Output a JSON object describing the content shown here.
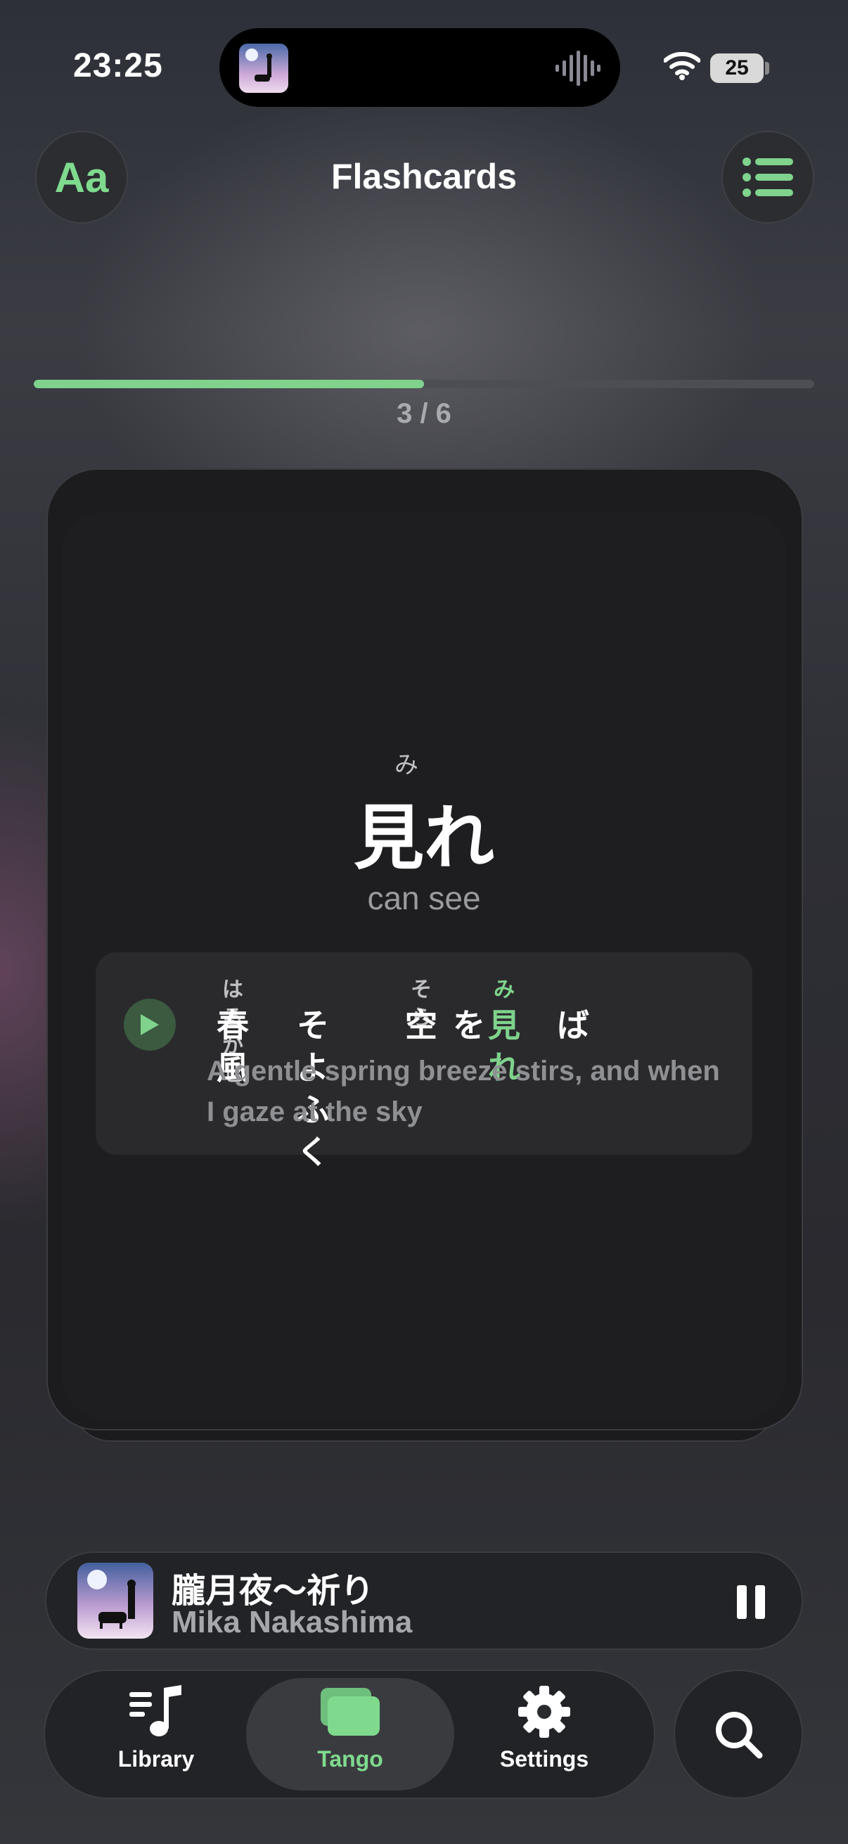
{
  "status_bar": {
    "time": "23:25",
    "battery": "25"
  },
  "header": {
    "title": "Flashcards",
    "font_button_label": "Aa"
  },
  "progress": {
    "label": "3 / 6",
    "current": 3,
    "total": 6,
    "fraction": 0.5
  },
  "card": {
    "reading": "み",
    "word": "見れ",
    "meaning": "can see",
    "example": {
      "segments": [
        {
          "text": "春風",
          "reading": "はるかぜ",
          "highlight": false
        },
        {
          "text": "そよふく",
          "reading": "",
          "highlight": false
        },
        {
          "text": "空",
          "reading": "そら",
          "highlight": false
        },
        {
          "text": "を",
          "reading": "",
          "highlight": false
        },
        {
          "text": "見れ",
          "reading": "み",
          "highlight": true
        },
        {
          "text": "ば",
          "reading": "",
          "highlight": false
        }
      ],
      "translation": "A gentle spring breeze stirs, and when I gaze at the sky"
    }
  },
  "now_playing": {
    "title": "朧月夜～祈り",
    "artist": "Mika Nakashima"
  },
  "tabs": [
    {
      "label": "Library",
      "icon": "music-list-icon"
    },
    {
      "label": "Tango",
      "icon": "cards-icon",
      "active": true
    },
    {
      "label": "Settings",
      "icon": "gear-icon"
    }
  ],
  "colors": {
    "accent": "#7fd38c",
    "card": "#1c1c1e"
  }
}
